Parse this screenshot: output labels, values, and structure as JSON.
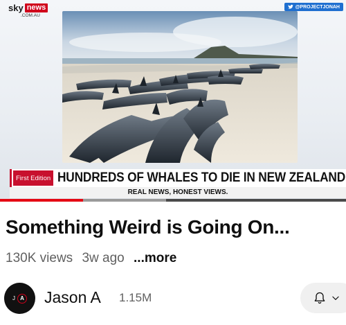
{
  "video": {
    "brand": {
      "sky": "sky",
      "news": "news",
      "domain": ".COM.AU"
    },
    "handle": "@PROJECTJONAH",
    "banner": {
      "tag": "First Edition",
      "headline": "HUNDREDS OF WHALES TO DIE IN NEW ZEALAND",
      "tagline": "REAL NEWS, HONEST VIEWS."
    },
    "progress": {
      "played_fraction": 0.24,
      "buffered_fraction": 0.48
    },
    "colors": {
      "accent": "#c8102e",
      "progress": "#e50914",
      "handle_bg": "#1f6fd0"
    }
  },
  "info": {
    "title": "Something Weird is Going On...",
    "views": "130K views",
    "age": "3w ago",
    "more": "...more"
  },
  "channel": {
    "name": "Jason A",
    "subscribers": "1.15M",
    "avatar": {
      "left": "J",
      "right": "A"
    },
    "icons": {
      "bell": "bell-icon",
      "chevron": "chevron-down-icon"
    }
  }
}
